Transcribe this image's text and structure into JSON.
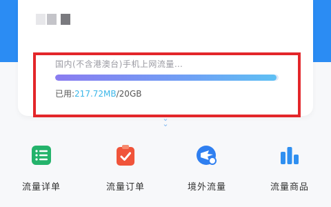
{
  "plan": {
    "title": "国内(不含港澳台)手机上网流量…",
    "usage_label": "已用:",
    "used": "217.72MB",
    "separator": "/",
    "total": "20GB",
    "used_fraction": 0.99
  },
  "actions": [
    {
      "label": "流量详单",
      "icon": "list-icon",
      "color": "#24b36b"
    },
    {
      "label": "流量订单",
      "icon": "clipboard-check-icon",
      "color": "#f0543a"
    },
    {
      "label": "境外流量",
      "icon": "globe-plane-icon",
      "color": "#2f7ff0"
    },
    {
      "label": "流量商品",
      "icon": "bar-chart-icon",
      "color": "#2f8ff0"
    }
  ],
  "colors": {
    "brand_blue": "#2b8cf3",
    "highlight": "#e3262a"
  }
}
